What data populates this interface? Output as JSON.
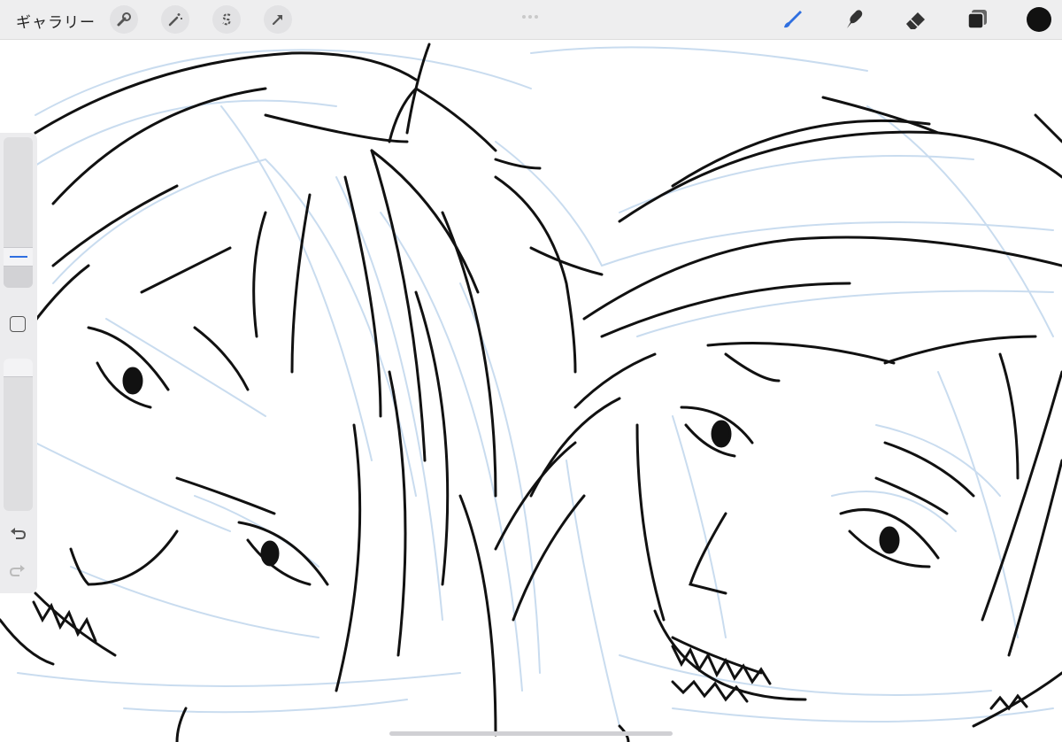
{
  "toolbar": {
    "gallery_label": "ギャラリー",
    "left_tools": [
      "wrench-icon",
      "magic-wand-icon",
      "selection-s-icon",
      "arrow-transform-icon"
    ],
    "right_tools": [
      "brush-icon",
      "smudge-icon",
      "eraser-icon",
      "layers-icon"
    ],
    "active_tool": "brush-icon",
    "accent_color": "#2f6fe0",
    "current_color": "#111111"
  },
  "sidebar": {
    "brush_size_level": 0.15,
    "opacity_level": 1.0,
    "modify_button_icon": "square-icon",
    "undo_icon": "undo-icon",
    "redo_icon": "redo-icon"
  },
  "canvas": {
    "sketch_color": "#c9dcef",
    "ink_color": "#111111"
  }
}
